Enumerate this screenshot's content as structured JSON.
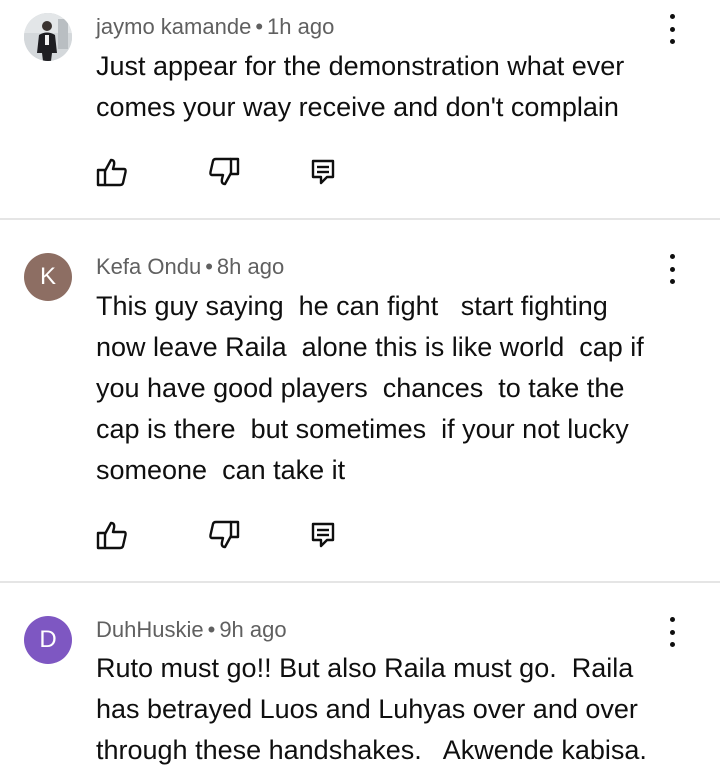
{
  "comments": [
    {
      "author": "jaymo kamande",
      "separator": "•",
      "time": "1h ago",
      "text": "Just appear for the demonstration what ever\ncomes your way receive and don't complain",
      "avatar": {
        "type": "photo",
        "color": "#cfd3d6"
      }
    },
    {
      "author": "Kefa Ondu",
      "separator": "•",
      "time": "8h ago",
      "text": "This guy saying  he can fight   start fighting\nnow leave Raila  alone this is like world  cap if\nyou have good players  chances  to take the\ncap is there  but sometimes  if your not lucky\nsomeone  can take it",
      "avatar": {
        "type": "letter",
        "letter": "K",
        "color": "#8d6e63"
      }
    },
    {
      "author": "DuhHuskie",
      "separator": "•",
      "time": "9h ago",
      "text": "Ruto must go!! But also Raila must go.  Raila\nhas betrayed Luos and Luhyas over and over\nthrough these handshakes.   Akwende kabisa.",
      "avatar": {
        "type": "letter",
        "letter": "D",
        "color": "#7e57c2"
      }
    }
  ],
  "icons": {
    "like": "thumbs-up-icon",
    "dislike": "thumbs-down-icon",
    "reply": "reply-icon",
    "more": "more-vert-icon"
  }
}
